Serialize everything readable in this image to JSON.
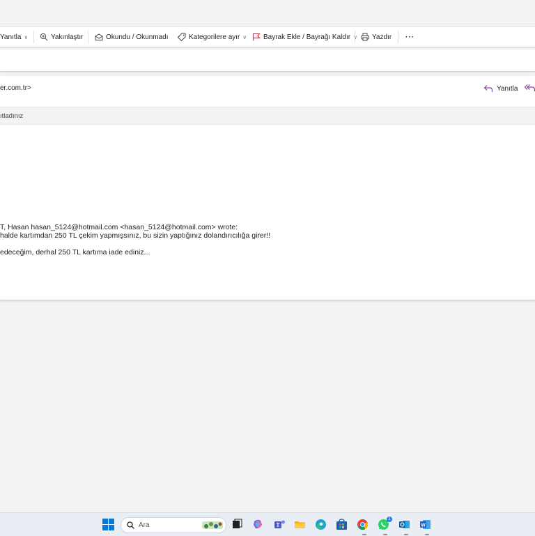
{
  "toolbar": {
    "reply_label": "Yanıtla",
    "zoom_label": "Yakınlaştır",
    "read_label": "Okundu / Okunmadı",
    "categorize_label": "Kategorilere ayır",
    "flag_label": "Bayrak Ekle / Bayrağı Kaldır",
    "print_label": "Yazdır",
    "more_label": "···"
  },
  "message": {
    "from_partial": "er.com.tr>",
    "reply_label": "Yanıtla",
    "info_text": "ıtladınız",
    "quote_header": "T, Hasan hasan_5124@hotmail.com <hasan_5124@hotmail.com> wrote:",
    "quote_line1": "halde kartımdan 250 TL çekim yapmışsınız, bu sizin yaptığınız dolandırıcılığa girer!!",
    "quote_line2": "edeceğim, derhal 250 TL kartıma iade ediniz..."
  },
  "taskbar": {
    "search_placeholder": "Ara",
    "whatsapp_badge": "1"
  },
  "colors": {
    "accent_purple": "#8a3ea8",
    "flag_red": "#c4314b",
    "windows_blue": "#0a78d7"
  }
}
